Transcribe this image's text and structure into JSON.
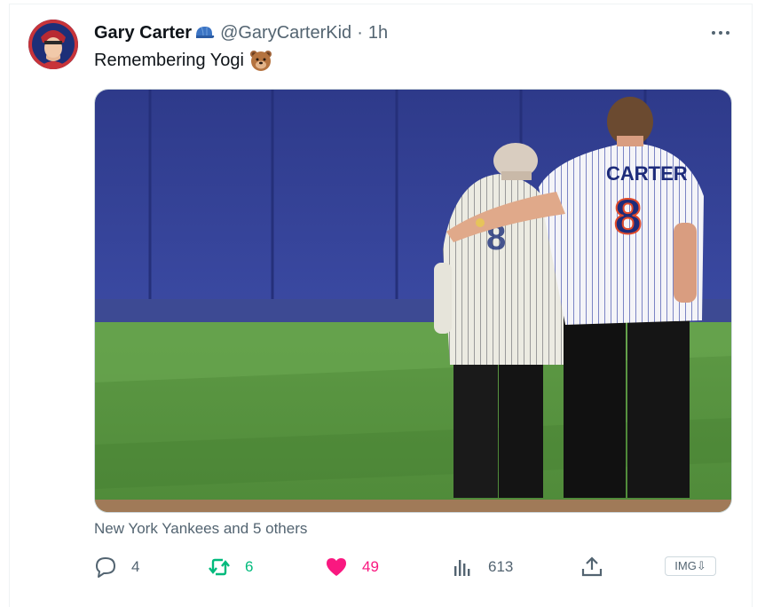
{
  "tweet": {
    "author_name": "Gary Carter",
    "handle": "@GaryCarterKid",
    "separator": "·",
    "time": "1h",
    "text": "Remembering Yogi",
    "tagged": "New York Yankees and 5 others",
    "media_alt": "Two men in baseball jerseys stand with arms around each other on a baseball field; the taller man's jersey reads CARTER 8",
    "jersey_name": "CARTER",
    "jersey_number": "8"
  },
  "actions": {
    "replies": "4",
    "retweets": "6",
    "likes": "49",
    "views": "613"
  },
  "image_button": "IMG⇩",
  "icons": {
    "avatar": "avatar-image",
    "verified_badge": "baseball-cap-icon",
    "emoji": "bear-face-icon",
    "more": "more-icon",
    "reply": "reply-icon",
    "retweet": "retweet-icon",
    "like": "heart-icon",
    "views": "views-icon",
    "share": "share-icon"
  },
  "colors": {
    "text": "#0f1419",
    "secondary": "#536471",
    "retweet_active": "#00ba7c",
    "like_active": "#f91880",
    "cap_blue": "#3b74c4"
  }
}
